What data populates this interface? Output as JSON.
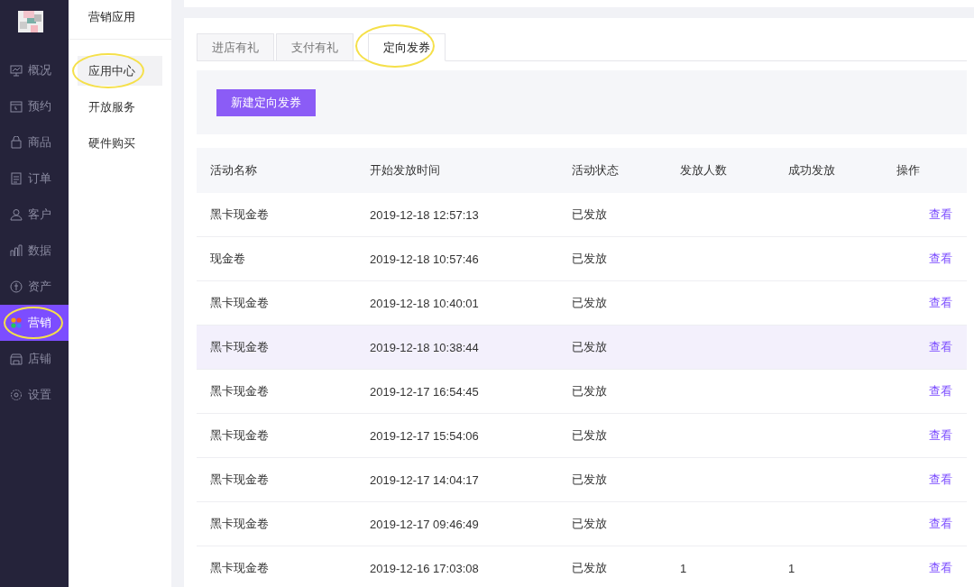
{
  "nav": {
    "items": [
      {
        "label": "概况",
        "selected": false,
        "circled": false
      },
      {
        "label": "预约",
        "selected": false,
        "circled": false
      },
      {
        "label": "商品",
        "selected": false,
        "circled": false
      },
      {
        "label": "订单",
        "selected": false,
        "circled": false
      },
      {
        "label": "客户",
        "selected": false,
        "circled": false
      },
      {
        "label": "数据",
        "selected": false,
        "circled": false
      },
      {
        "label": "资产",
        "selected": false,
        "circled": false
      },
      {
        "label": "营销",
        "selected": true,
        "circled": true
      },
      {
        "label": "店铺",
        "selected": false,
        "circled": false
      },
      {
        "label": "设置",
        "selected": false,
        "circled": false
      }
    ]
  },
  "subnav": {
    "title": "营销应用",
    "items": [
      {
        "label": "应用中心",
        "selected": true,
        "circled": true
      },
      {
        "label": "开放服务",
        "selected": false,
        "circled": false
      },
      {
        "label": "硬件购买",
        "selected": false,
        "circled": false
      }
    ]
  },
  "tabs": [
    {
      "label": "进店有礼",
      "selected": false,
      "circled": false
    },
    {
      "label": "支付有礼",
      "selected": false,
      "circled": false
    },
    {
      "label": "定向发券",
      "selected": true,
      "circled": true
    }
  ],
  "new_button": "新建定向发券",
  "table": {
    "columns": [
      "活动名称",
      "开始发放时间",
      "活动状态",
      "发放人数",
      "成功发放",
      "操作"
    ],
    "rows": [
      {
        "name": "黑卡现金卷",
        "time": "2019-12-18 12:57:13",
        "status": "已发放",
        "action": "查看",
        "selected": false
      },
      {
        "name": "现金卷",
        "time": "2019-12-18 10:57:46",
        "status": "已发放",
        "action": "查看",
        "selected": false
      },
      {
        "name": "黑卡现金卷",
        "time": "2019-12-18 10:40:01",
        "status": "已发放",
        "action": "查看",
        "selected": false
      },
      {
        "name": "黑卡现金卷",
        "time": "2019-12-18 10:38:44",
        "status": "已发放",
        "action": "查看",
        "selected": true
      },
      {
        "name": "黑卡现金卷",
        "time": "2019-12-17 16:54:45",
        "status": "已发放",
        "action": "查看",
        "selected": false
      },
      {
        "name": "黑卡现金卷",
        "time": "2019-12-17 15:54:06",
        "status": "已发放",
        "action": "查看",
        "selected": false
      },
      {
        "name": "黑卡现金卷",
        "time": "2019-12-17 14:04:17",
        "status": "已发放",
        "action": "查看",
        "selected": false
      },
      {
        "name": "黑卡现金卷",
        "time": "2019-12-17 09:46:49",
        "status": "已发放",
        "action": "查看",
        "selected": false
      },
      {
        "name": "黑卡现金卷",
        "time": "2019-12-16 17:03:08",
        "status": "已发放",
        "count": "1",
        "success": "1",
        "action": "查看",
        "selected": false
      }
    ]
  }
}
